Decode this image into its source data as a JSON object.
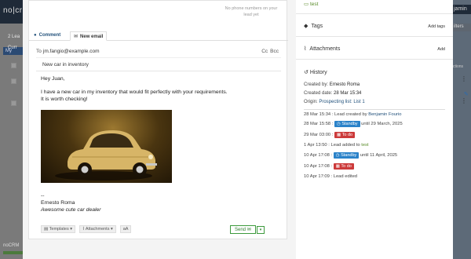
{
  "background": {
    "logo": "no|cr",
    "left_items": [
      "My",
      "2",
      "Lea",
      "Curr"
    ],
    "user": "jamin",
    "filters": "ilters",
    "actions": "ctions",
    "footer": "noCRM"
  },
  "lead": {
    "no_phone_text": "No phone numbers on your lead yet",
    "tabs": [
      {
        "label": "Comment",
        "icon": "comment-icon"
      },
      {
        "label": "New email",
        "icon": "envelope-icon"
      }
    ],
    "email": {
      "to_label": "To",
      "to_value": "jm.fangio@example.com",
      "cc": "Cc",
      "bcc": "Bcc",
      "subject": "New car in inventory",
      "greeting": "Hey Juan,",
      "line1": "I have a new car in my inventory that would fit perfectly with your requirements.",
      "line2": "It is worth checking!",
      "sig_dash": "--",
      "sig_name": "Ernesto Roma",
      "sig_title": "Awesome cute car dealer"
    },
    "toolbar": {
      "templates": "Templates",
      "attachments": "Attachments",
      "text_size": "aA",
      "send": "Send"
    }
  },
  "side": {
    "step": "test",
    "tags_label": "Tags",
    "add_tags": "Add tags",
    "attachments_label": "Attachments",
    "add": "Add",
    "history_label": "History",
    "created_by_label": "Created by:",
    "created_by": "Ernesto Roma",
    "created_date_label": "Created date:",
    "created_date": "28 Mar 15:34",
    "origin_label": "Origin:",
    "origin": "Prospecting list: List 1",
    "history": [
      {
        "time": "28 Mar 15:34 :",
        "text": "Lead created by",
        "link": "Benjamin Fourio"
      },
      {
        "time": "28 Mar 15:58 :",
        "badge": "Standby",
        "badge_type": "standby",
        "text": "until 29 March, 2025"
      },
      {
        "time": "29 Mar 03:00 :",
        "badge": "To do",
        "badge_type": "todo"
      },
      {
        "time": "1 Apr 13:50 :",
        "text": "Lead added to",
        "green": "test"
      },
      {
        "time": "10 Apr 17:08 :",
        "badge": "Standby",
        "badge_type": "standby",
        "text": "until 11 April, 2025"
      },
      {
        "time": "10 Apr 17:08 :",
        "badge": "To do",
        "badge_type": "todo"
      },
      {
        "time": "10 Apr 17:09 :",
        "text": "Lead edited"
      }
    ]
  },
  "colors": {
    "accent_blue": "#2a82c9",
    "todo_red": "#cc3a3a",
    "send_green": "#3c9a3c",
    "step_green": "#5a8c2a"
  }
}
